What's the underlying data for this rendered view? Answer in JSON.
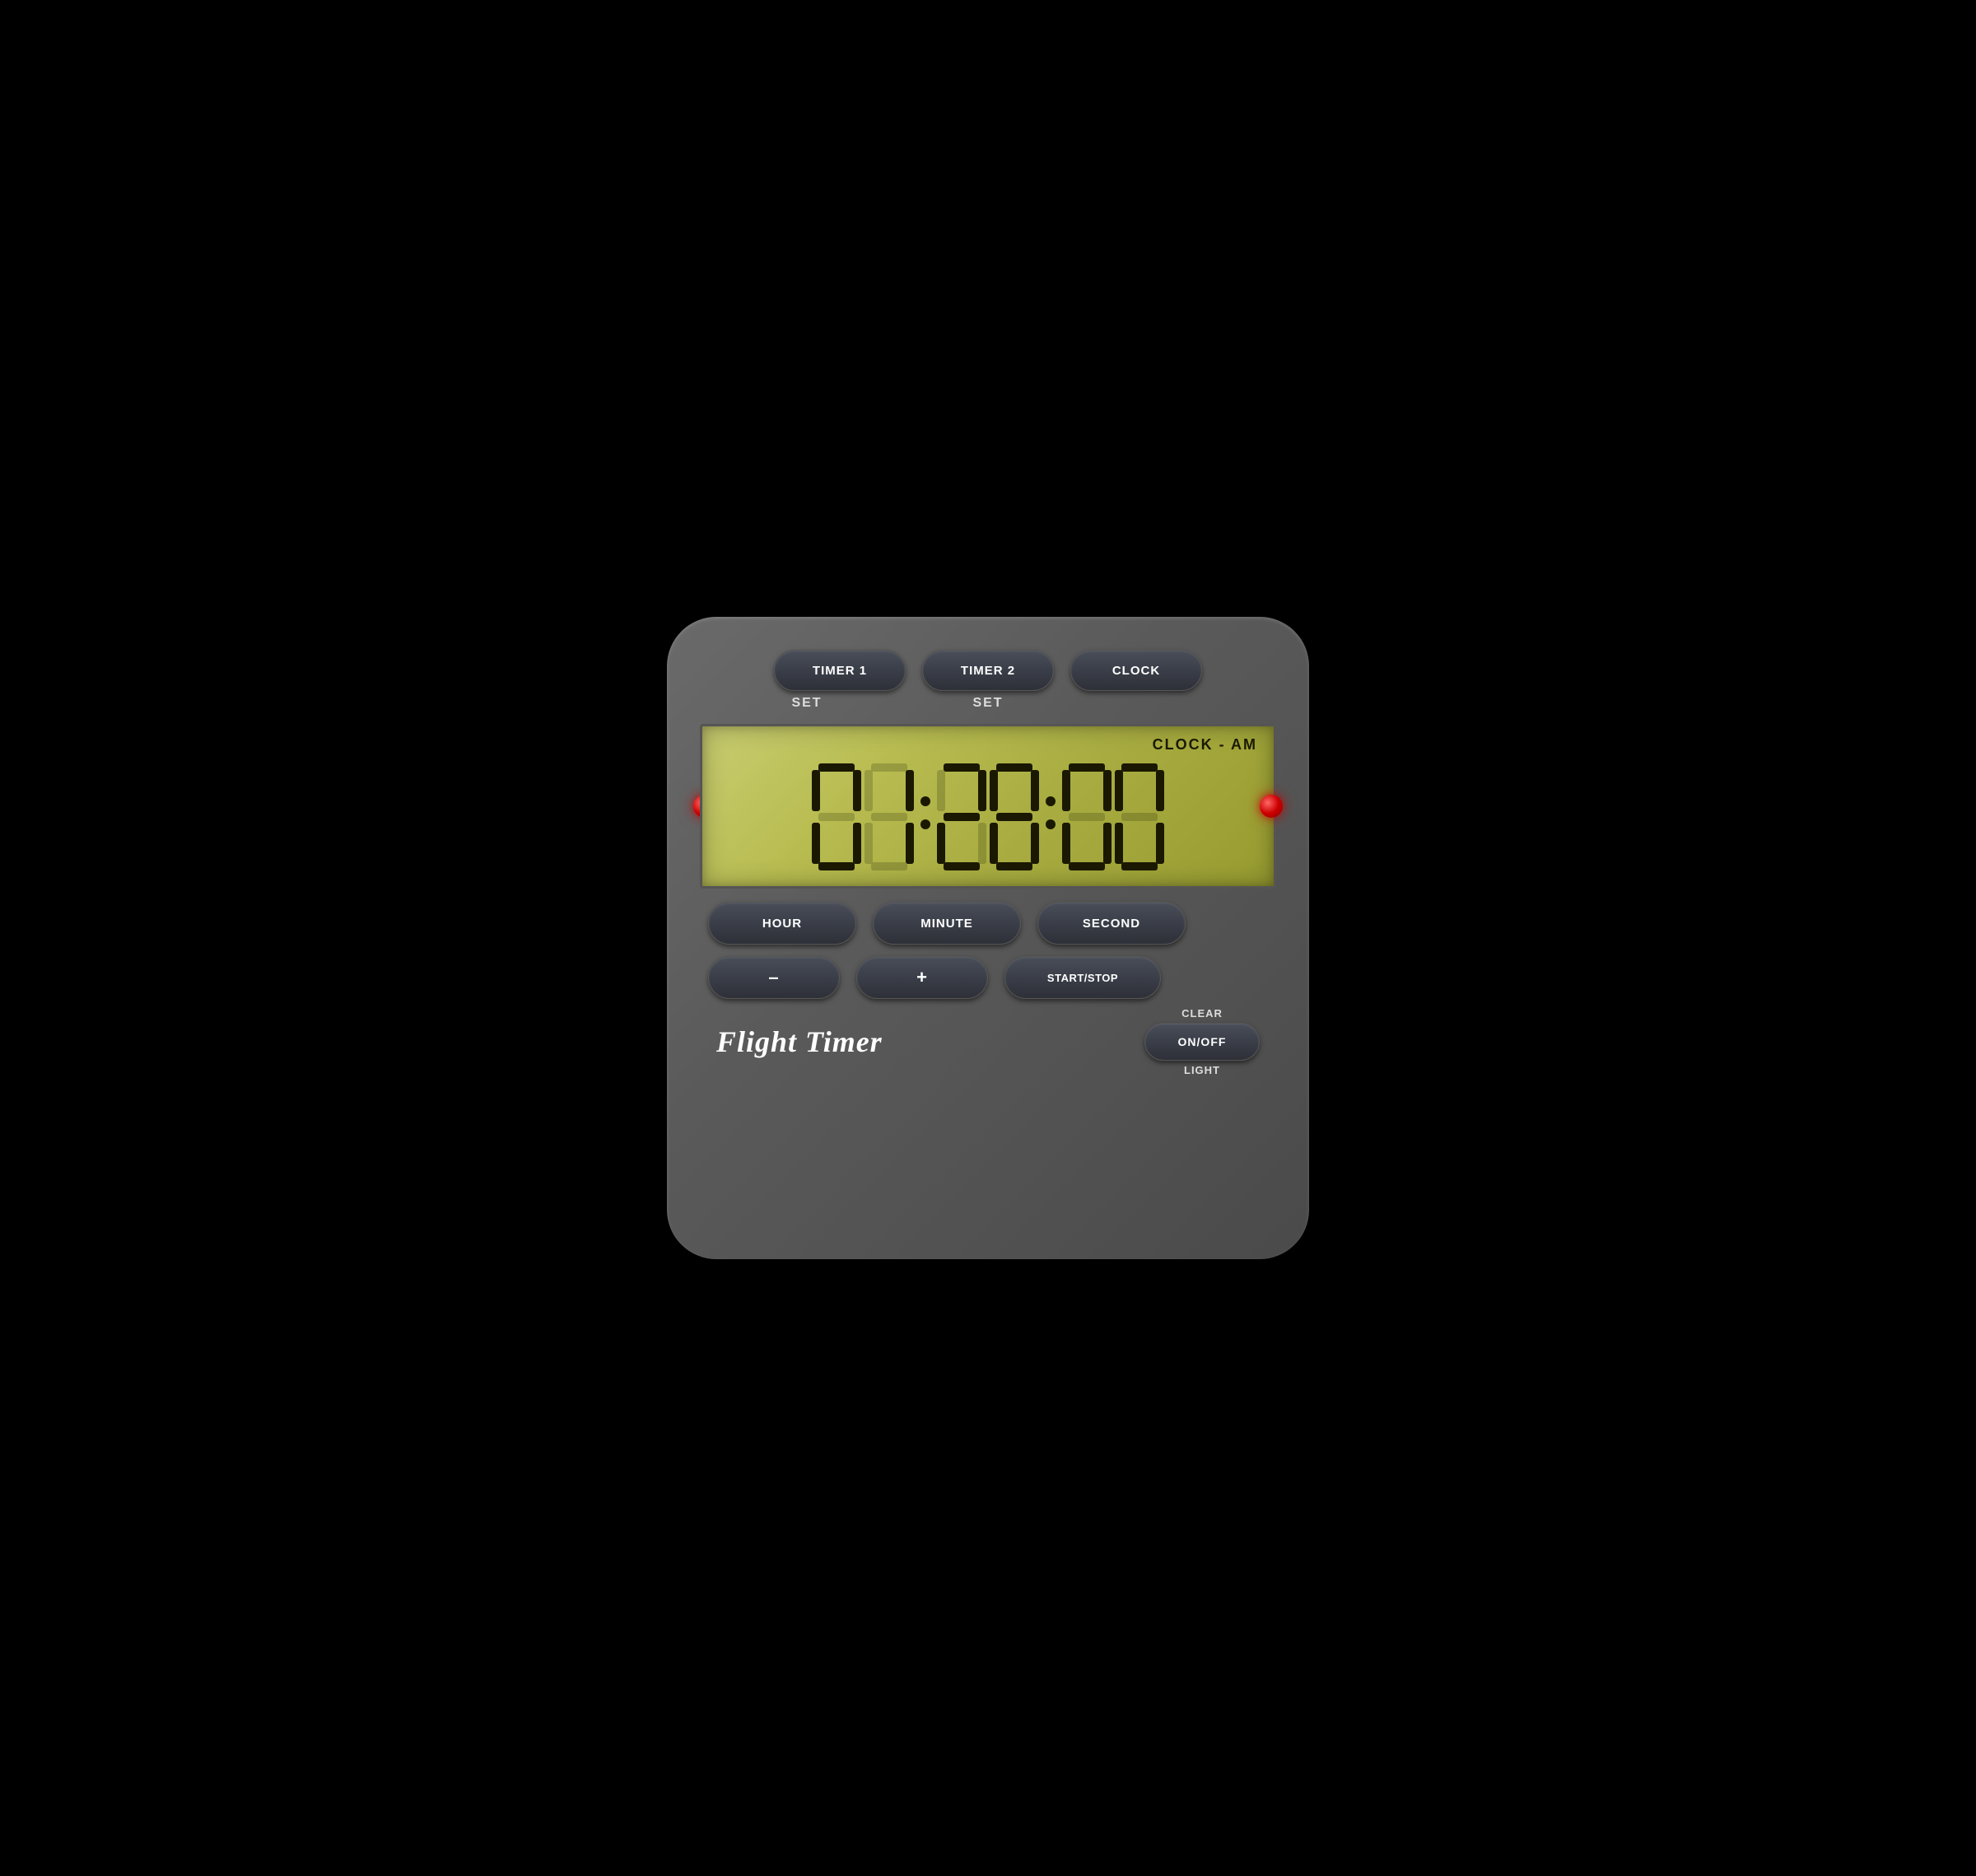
{
  "device": {
    "title": "Flight Timer"
  },
  "top_buttons": [
    {
      "id": "timer1",
      "label": "TIMER 1"
    },
    {
      "id": "timer2",
      "label": "TIMER 2"
    },
    {
      "id": "clock",
      "label": "CLOCK"
    }
  ],
  "set_labels": [
    {
      "id": "set1",
      "label": "SET"
    },
    {
      "id": "set2",
      "label": "SET"
    }
  ],
  "display": {
    "mode_label": "CLOCK - AM",
    "time": "01:28:00",
    "digits": [
      "0",
      "1",
      "2",
      "8",
      "0",
      "0"
    ]
  },
  "bottom_buttons_row1": [
    {
      "id": "hour",
      "label": "HOUR"
    },
    {
      "id": "minute",
      "label": "MINUTE"
    },
    {
      "id": "second",
      "label": "SECOND"
    }
  ],
  "bottom_buttons_row2": [
    {
      "id": "minus",
      "label": "–"
    },
    {
      "id": "plus",
      "label": "+"
    }
  ],
  "right_controls": {
    "start_stop": {
      "label": "START/STOP"
    },
    "clear": {
      "label": "CLEAR"
    },
    "on_off": {
      "label": "ON/OFF"
    },
    "light": {
      "label": "LIGHT"
    }
  },
  "icons": {
    "led_left": "red-led",
    "led_right": "red-led"
  }
}
